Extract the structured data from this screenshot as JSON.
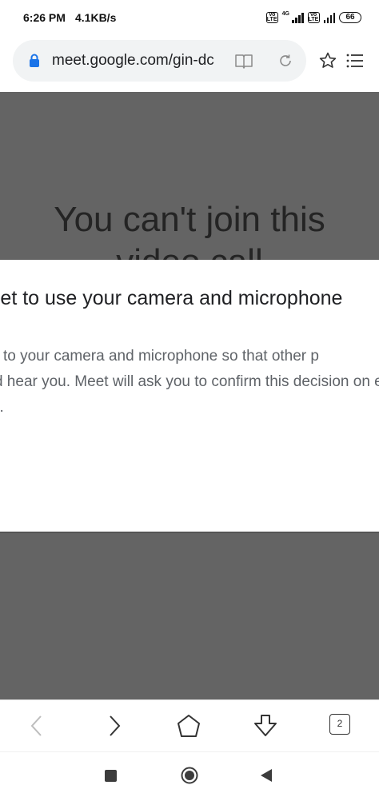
{
  "status_bar": {
    "time": "6:26 PM",
    "speed": "4.1KB/s",
    "network_label": "4G",
    "battery": "66"
  },
  "browser": {
    "url": "meet.google.com/gin-dc",
    "tab_count": "2"
  },
  "page": {
    "heading_line1": "You can't join this",
    "heading_line2": "video call",
    "dialog_title": "Allow Meet to use your camera and microphone",
    "dialog_body_lines": [
      "Meet needs access to your camera and microphone so that other p",
      "can see and hear you. Meet will ask you to confirm this decision on eacl",
      "you use."
    ]
  },
  "colors": {
    "overlay": "#646464",
    "lock_accent": "#1a73e8",
    "url_bar_bg": "#f1f3f4"
  }
}
